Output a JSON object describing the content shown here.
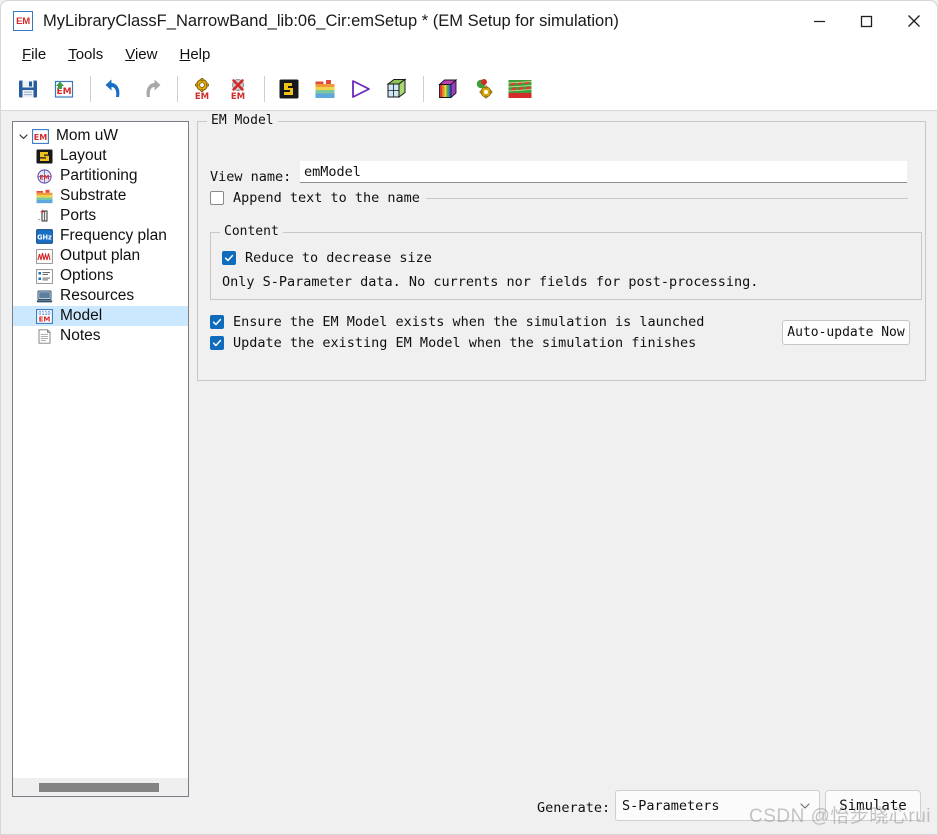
{
  "window": {
    "title": "MyLibraryClassF_NarrowBand_lib:06_Cir:emSetup * (EM Setup for simulation)",
    "app_icon_text": "EM",
    "minimize_label": "Minimize",
    "maximize_label": "Maximize",
    "close_label": "Close"
  },
  "menubar": {
    "items": [
      {
        "accel": "F",
        "rest": "ile",
        "name": "file"
      },
      {
        "accel": "T",
        "rest": "ools",
        "name": "tools"
      },
      {
        "accel": "V",
        "rest": "iew",
        "name": "view"
      },
      {
        "accel": "H",
        "rest": "elp",
        "name": "help"
      }
    ]
  },
  "toolbar": {
    "buttons": [
      {
        "name": "save-icon",
        "tip": "Save"
      },
      {
        "name": "save-em-setup-icon",
        "tip": "Save EM setup"
      },
      {
        "name": "undo-icon",
        "tip": "Undo"
      },
      {
        "name": "redo-icon",
        "tip": "Redo"
      },
      {
        "name": "em-settings-icon",
        "tip": "EM settings"
      },
      {
        "name": "em-delete-icon",
        "tip": "Delete EM"
      },
      {
        "name": "layout-icon",
        "tip": "Layout"
      },
      {
        "name": "substrate-icon",
        "tip": "Substrate"
      },
      {
        "name": "simulate-play-icon",
        "tip": "Simulate"
      },
      {
        "name": "3d-view-icon",
        "tip": "3D view"
      },
      {
        "name": "rainbow-cube-icon",
        "tip": "Visualization"
      },
      {
        "name": "em-cosim-icon",
        "tip": "EM cosimulation"
      },
      {
        "name": "mesh-view-icon",
        "tip": "Mesh view"
      }
    ]
  },
  "tree": {
    "root": {
      "label": "Mom uW",
      "icon": "em-icon",
      "expanded": true
    },
    "items": [
      {
        "label": "Layout",
        "icon": "layout-icon"
      },
      {
        "label": "Partitioning",
        "icon": "partitioning-icon"
      },
      {
        "label": "Substrate",
        "icon": "substrate-icon"
      },
      {
        "label": "Ports",
        "icon": "ports-icon"
      },
      {
        "label": "Frequency plan",
        "icon": "ghz-icon"
      },
      {
        "label": "Output plan",
        "icon": "output-plan-icon"
      },
      {
        "label": "Options",
        "icon": "options-icon"
      },
      {
        "label": "Resources",
        "icon": "resources-icon"
      },
      {
        "label": "Model",
        "icon": "model-icon",
        "selected": true
      },
      {
        "label": "Notes",
        "icon": "notes-icon"
      }
    ]
  },
  "main": {
    "group_title": "EM Model",
    "view_name_label": "View name:",
    "view_name_value": "emModel",
    "view_name_placeholder": "emModel",
    "append_text_label": "Append text to the name",
    "append_text_checked": false,
    "content": {
      "group_title": "Content",
      "reduce_label": "Reduce to decrease size",
      "reduce_checked": true,
      "note": "Only S-Parameter data. No currents nor fields for post-processing."
    },
    "ensure_label": "Ensure the EM Model exists when the simulation is launched",
    "ensure_checked": true,
    "update_label": "Update the existing EM Model when the simulation finishes",
    "update_checked": true,
    "auto_update_button": "Auto-update Now"
  },
  "bottom": {
    "generate_label": "Generate:",
    "generate_value": "S-Parameters",
    "generate_options": [
      "S-Parameters"
    ],
    "simulate_button": "Simulate"
  },
  "watermark": {
    "text": "CSDN @怡步晓心rui"
  },
  "colors": {
    "accent_blue": "#0f6cbd",
    "tree_selection": "#cce8ff",
    "title_icon_red": "#d42a2a"
  }
}
